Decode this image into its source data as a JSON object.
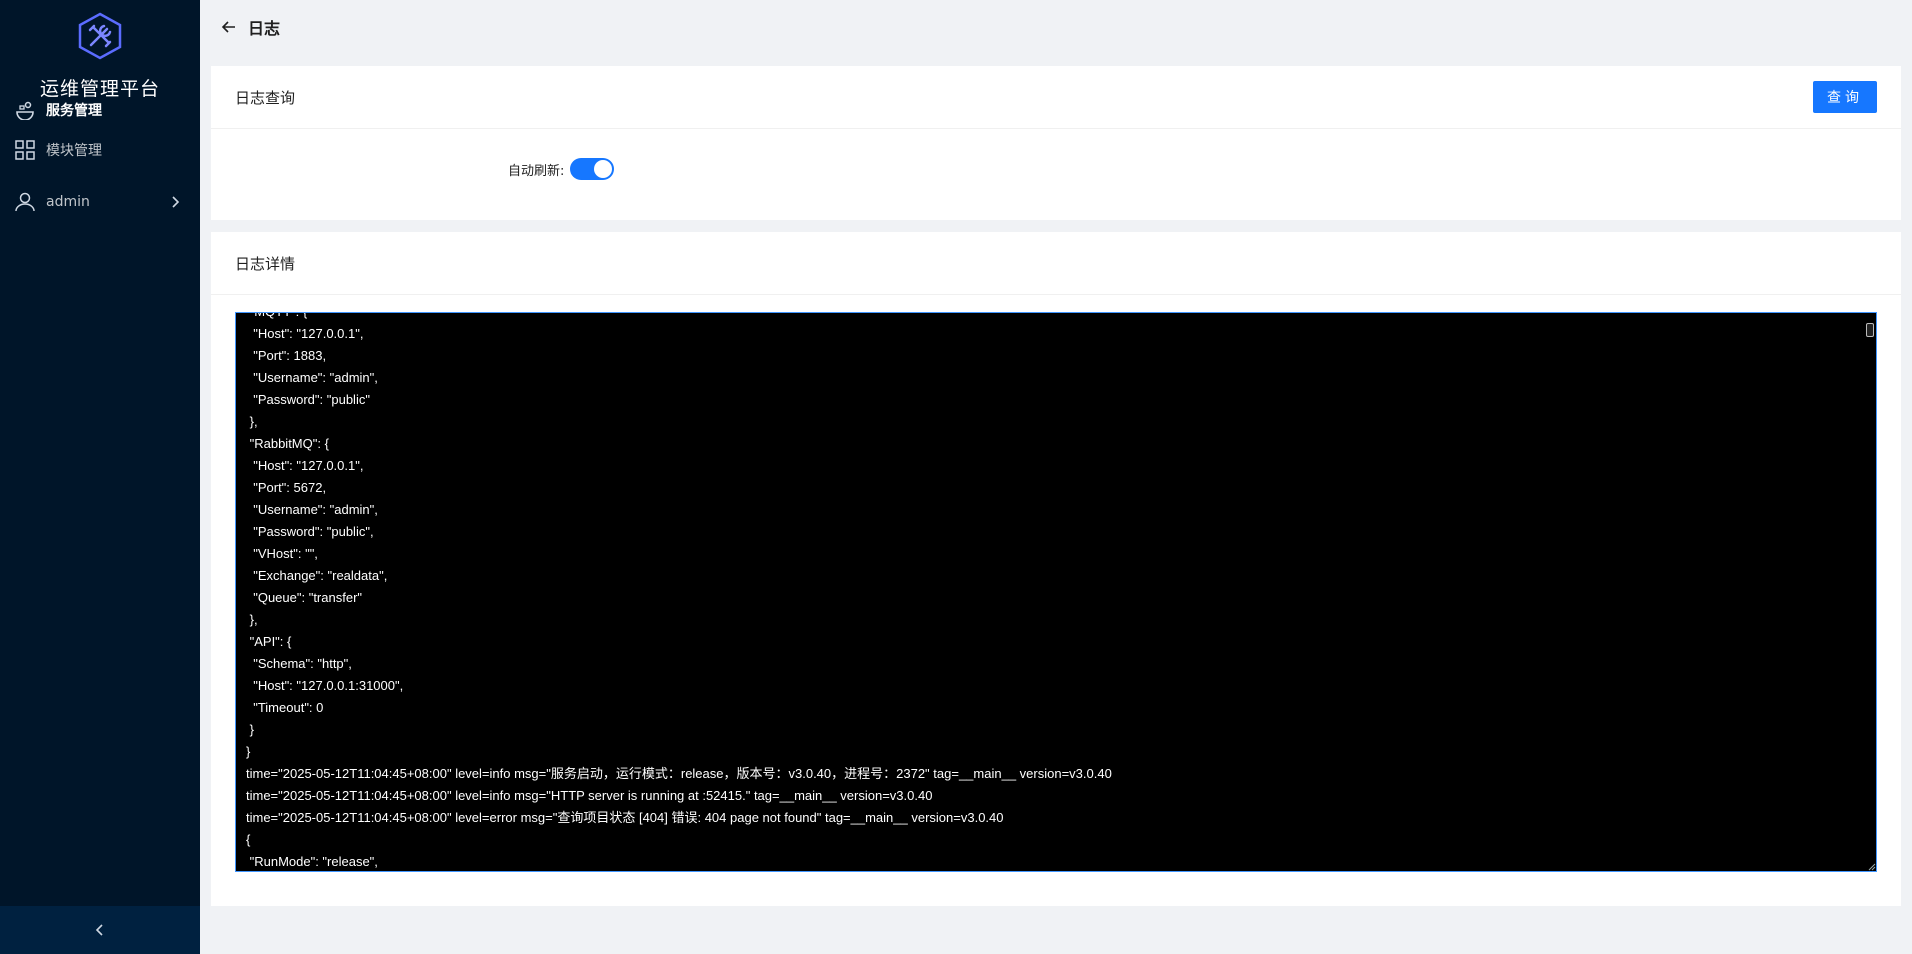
{
  "sidebar": {
    "brand_title": "运维管理平台",
    "items": [
      {
        "label": "服务管理",
        "icon": "service-icon",
        "active": true
      },
      {
        "label": "模块管理",
        "icon": "module-grid-icon",
        "active": false
      },
      {
        "label": "admin",
        "icon": "user-icon",
        "active": false
      }
    ],
    "collapse_icon": "chevron-left-icon"
  },
  "header": {
    "back_icon": "arrow-left-icon",
    "title": "日志"
  },
  "query_card": {
    "title": "日志查询",
    "query_button": "查询",
    "auto_refresh_label": "自动刷新:",
    "auto_refresh_on": true
  },
  "detail_card": {
    "title": "日志详情",
    "log_lines": [
      " \"MQTT\": {",
      "  \"Host\": \"127.0.0.1\",",
      "  \"Port\": 1883,",
      "  \"Username\": \"admin\",",
      "  \"Password\": \"public\"",
      " },",
      " \"RabbitMQ\": {",
      "  \"Host\": \"127.0.0.1\",",
      "  \"Port\": 5672,",
      "  \"Username\": \"admin\",",
      "  \"Password\": \"public\",",
      "  \"VHost\": \"\",",
      "  \"Exchange\": \"realdata\",",
      "  \"Queue\": \"transfer\"",
      " },",
      " \"API\": {",
      "  \"Schema\": \"http\",",
      "  \"Host\": \"127.0.0.1:31000\",",
      "  \"Timeout\": 0",
      " }",
      "}",
      "time=\"2025-05-12T11:04:45+08:00\" level=info msg=\"服务启动，运行模式：release，版本号：v3.0.40，进程号：2372\" tag=__main__ version=v3.0.40",
      "time=\"2025-05-12T11:04:45+08:00\" level=info msg=\"HTTP server is running at :52415.\" tag=__main__ version=v3.0.40",
      "time=\"2025-05-12T11:04:45+08:00\" level=error msg=\"查询项目状态 [404] 错误: 404 page not found\" tag=__main__ version=v3.0.40",
      "{",
      " \"RunMode\": \"release\","
    ]
  }
}
